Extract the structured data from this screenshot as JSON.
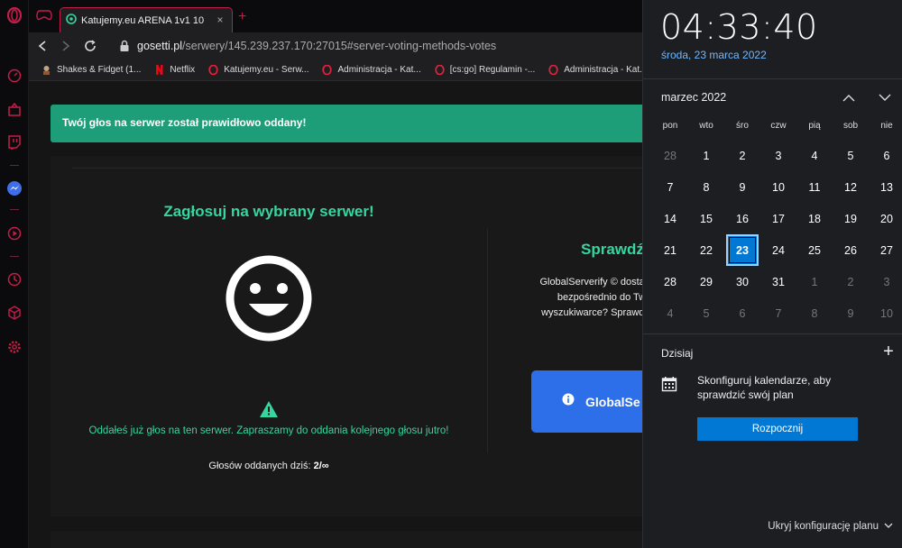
{
  "colors": {
    "accent_red": "#c21e49",
    "green": "#35d69f",
    "alert_bg": "#1e9e78",
    "blue_btn": "#2c6fe8",
    "win_accent": "#0078d4",
    "win_date": "#70b8ff"
  },
  "browser": {
    "tab": {
      "title": "Katujemy.eu ARENA 1v1 10",
      "icon": "server-globe-icon",
      "close": "×"
    },
    "new_tab": "+",
    "url": {
      "domain": "gosetti.pl",
      "path": "/serwery/145.239.237.170:27015#server-voting-methods-votes"
    },
    "bookmarks": [
      {
        "label": "Shakes & Fidget (1...",
        "icon": "game-character-icon"
      },
      {
        "label": "Netflix",
        "icon": "netflix-icon"
      },
      {
        "label": "Katujemy.eu - Serw...",
        "icon": "opera-icon"
      },
      {
        "label": "Administracja - Kat...",
        "icon": "opera-icon"
      },
      {
        "label": "[cs:go] Regulamin -...",
        "icon": "opera-icon"
      },
      {
        "label": "Administracja - Kat...",
        "icon": "opera-icon"
      }
    ]
  },
  "page": {
    "alert": "Twój głos na serwer został prawidłowo oddany!",
    "vote_title": "Zagłosuj na wybrany serwer!",
    "warning": "Oddałeś już głos na ten serwer. Zapraszamy do oddania kolejnego głosu jutro!",
    "votes_label": "Głosów oddanych dziś:",
    "votes_value": "2/∞",
    "check_title": "Sprawdź",
    "gs_desc_lines": [
      "GlobalServerify © dostarcza",
      "bezpośrednio do Tw",
      "wyszukiwarce? Sprawdź Gl"
    ],
    "gs_button": "GlobalSe"
  },
  "flyout": {
    "time": "04:33:40",
    "date_long": "środa, 23 marca 2022",
    "month": "marzec 2022",
    "weekdays": [
      "pon",
      "wto",
      "śro",
      "czw",
      "pią",
      "sob",
      "nie"
    ],
    "days": [
      {
        "d": "28",
        "o": true
      },
      {
        "d": "1"
      },
      {
        "d": "2"
      },
      {
        "d": "3"
      },
      {
        "d": "4"
      },
      {
        "d": "5"
      },
      {
        "d": "6"
      },
      {
        "d": "7"
      },
      {
        "d": "8"
      },
      {
        "d": "9"
      },
      {
        "d": "10"
      },
      {
        "d": "11"
      },
      {
        "d": "12"
      },
      {
        "d": "13"
      },
      {
        "d": "14"
      },
      {
        "d": "15"
      },
      {
        "d": "16"
      },
      {
        "d": "17"
      },
      {
        "d": "18"
      },
      {
        "d": "19"
      },
      {
        "d": "20"
      },
      {
        "d": "21"
      },
      {
        "d": "22"
      },
      {
        "d": "23",
        "t": true
      },
      {
        "d": "24"
      },
      {
        "d": "25"
      },
      {
        "d": "26"
      },
      {
        "d": "27"
      },
      {
        "d": "28"
      },
      {
        "d": "29"
      },
      {
        "d": "30"
      },
      {
        "d": "31"
      },
      {
        "d": "1",
        "o": true
      },
      {
        "d": "2",
        "o": true
      },
      {
        "d": "3",
        "o": true
      },
      {
        "d": "4",
        "o": true
      },
      {
        "d": "5",
        "o": true
      },
      {
        "d": "6",
        "o": true
      },
      {
        "d": "7",
        "o": true
      },
      {
        "d": "8",
        "o": true
      },
      {
        "d": "9",
        "o": true
      },
      {
        "d": "10",
        "o": true
      }
    ],
    "today_label": "Dzisiaj",
    "add": "+",
    "plan_text": "Skonfiguruj kalendarze, aby sprawdzić swój plan",
    "start_button": "Rozpocznij",
    "hide_config": "Ukryj konfigurację planu"
  }
}
